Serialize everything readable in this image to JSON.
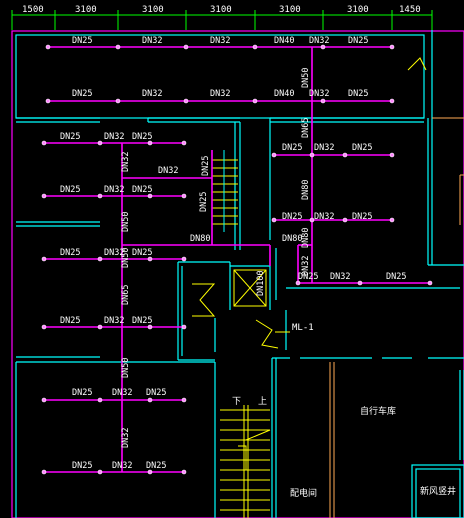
{
  "colors": {
    "background": "#000000",
    "dimension": "#00ff00",
    "pipe": "#ff00ff",
    "wall": "#00ffff",
    "label": "#ffffff",
    "door": "#ffff00",
    "node": "#ff88ff"
  },
  "dimensions": [
    "1500",
    "3100",
    "3100",
    "3100",
    "3100",
    "3100",
    "1450"
  ],
  "pipe_labels": {
    "r1": [
      "DN25",
      "DN32",
      "DN32",
      "DN40",
      "DN32",
      "DN25"
    ],
    "r2": [
      "DN25",
      "DN32",
      "DN32",
      "DN40",
      "DN32",
      "DN25"
    ],
    "r3": [
      "DN25",
      "DN32",
      "DN25"
    ],
    "r4": [
      "DN25",
      "DN32",
      "DN25"
    ],
    "r5": [
      "DN25",
      "DN32",
      "DN25"
    ],
    "r6": [
      "DN25",
      "DN32",
      "DN25"
    ],
    "r7": [
      "DN25",
      "DN32",
      "DN25"
    ],
    "r8": [
      "DN25",
      "DN32",
      "DN25"
    ],
    "right1": [
      "DN25",
      "DN32",
      "DN25"
    ],
    "right2": [
      "DN25",
      "DN32",
      "DN25"
    ],
    "right3": [
      "DN25",
      "DN32",
      "DN25"
    ],
    "horiz": {
      "a": "DN32",
      "b": "DN80",
      "c": "DN80"
    }
  },
  "riser_labels": {
    "left": [
      "DN32",
      "DN50",
      "DN50",
      "DN65",
      "DN50",
      "DN32"
    ],
    "mid": [
      "DN50",
      "DN65",
      "DN80",
      "DN80",
      "DN32"
    ],
    "small": [
      "DN25",
      "DN25",
      "DN100"
    ]
  },
  "room_labels": {
    "stair_down": "下",
    "stair_up": "上",
    "bike": "自行车库",
    "room_a": "配电间",
    "room_b": "新风竖井",
    "marker": "ML-1"
  }
}
